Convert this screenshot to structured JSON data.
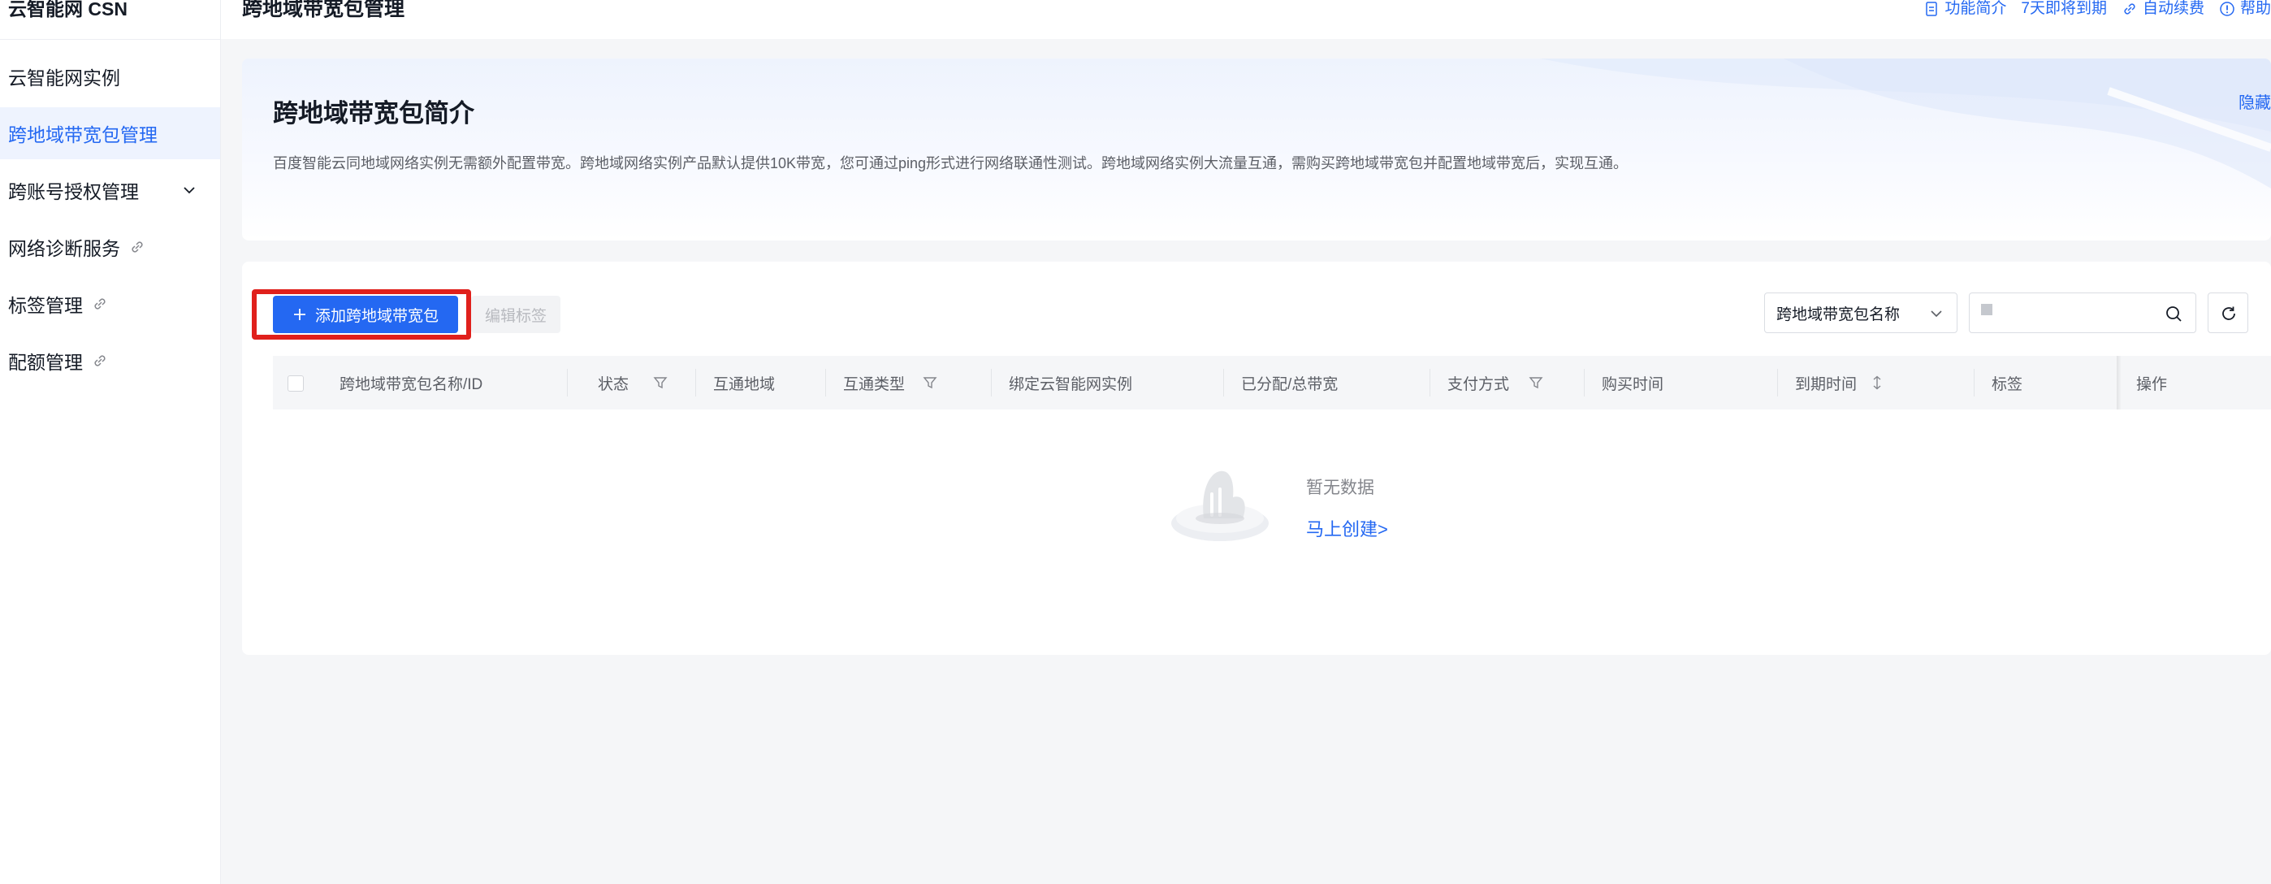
{
  "sidebar": {
    "title": "云智能网 CSN",
    "items": [
      {
        "label": "云智能网实例"
      },
      {
        "label": "跨地域带宽包管理"
      },
      {
        "label": "跨账号授权管理"
      },
      {
        "label": "网络诊断服务"
      },
      {
        "label": "标签管理"
      },
      {
        "label": "配额管理"
      }
    ]
  },
  "header": {
    "title": "跨地域带宽包管理",
    "links": {
      "intro": "功能简介",
      "expiring": "7天即将到期",
      "auto_renew": "自动续费",
      "help": "帮助"
    }
  },
  "intro": {
    "title": "跨地域带宽包简介",
    "description": "百度智能云同地域网络实例无需额外配置带宽。跨地域网络实例产品默认提供10K带宽，您可通过ping形式进行网络联通性测试。跨地域网络实例大流量互通，需购买跨地域带宽包并配置地域带宽后，实现互通。",
    "hide": "隐藏"
  },
  "toolbar": {
    "add_label": "添加跨地域带宽包",
    "edit_tags_label": "编辑标签",
    "search_field_select": "跨地域带宽包名称",
    "search_value": ""
  },
  "table": {
    "columns": {
      "name": "跨地域带宽包名称/ID",
      "status": "状态",
      "region": "互通地域",
      "type": "互通类型",
      "instance": "绑定云智能网实例",
      "bandwidth": "已分配/总带宽",
      "payment": "支付方式",
      "purchase_time": "购买时间",
      "expire_time": "到期时间",
      "tags": "标签",
      "actions": "操作"
    },
    "empty": {
      "text": "暂无数据",
      "create_link": "马上创建>"
    }
  },
  "colors": {
    "primary": "#2468f2",
    "highlight": "#e0201c",
    "active_bg": "#eef3fe"
  }
}
